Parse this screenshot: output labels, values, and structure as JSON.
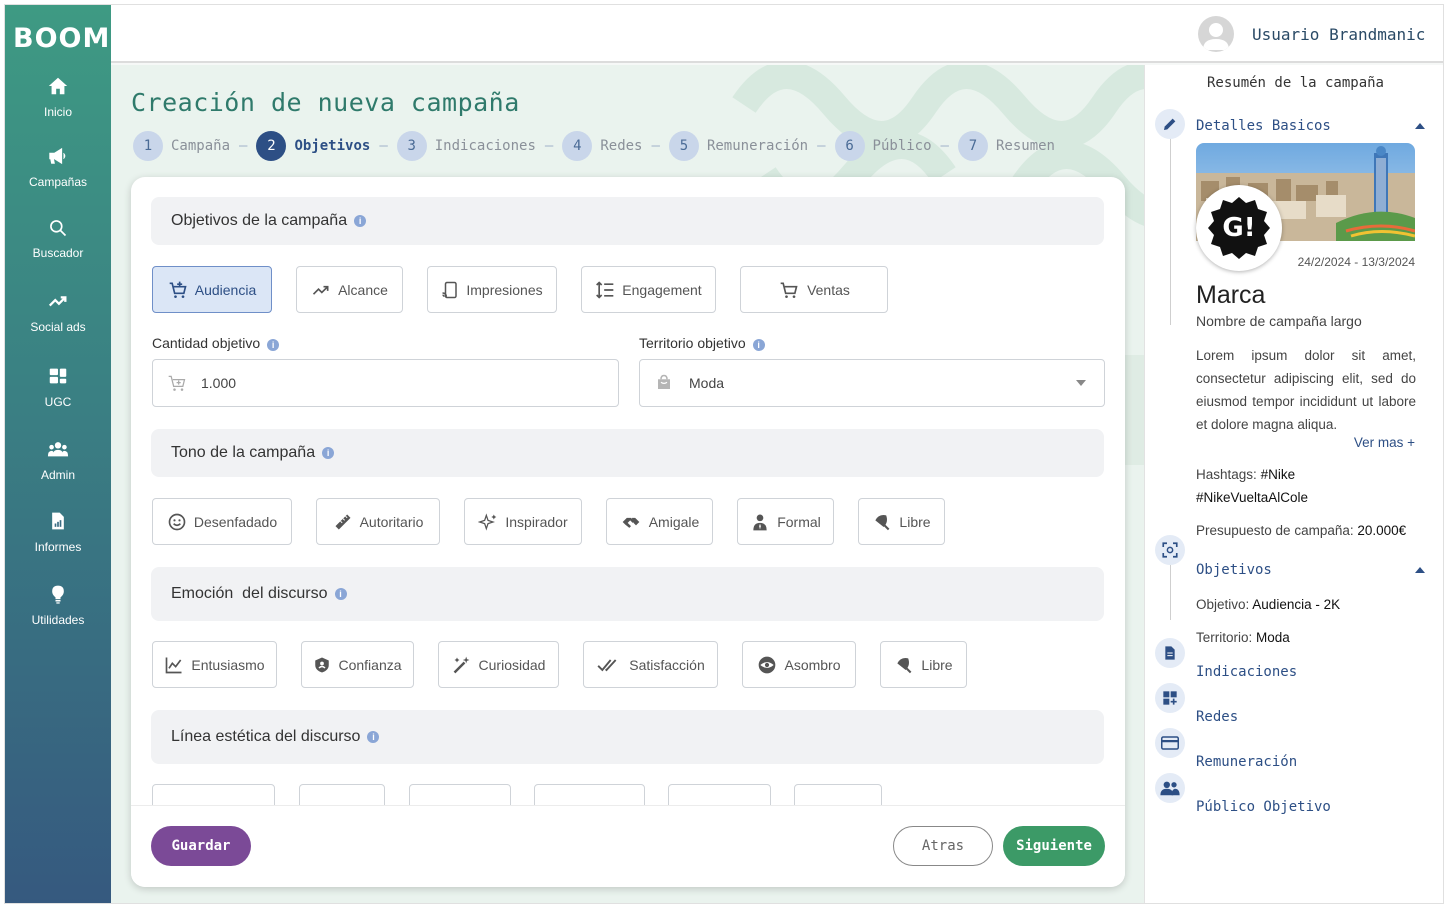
{
  "app": {
    "logo": "BOOM"
  },
  "sidebar": {
    "items": [
      {
        "label": "Inicio",
        "icon": "home-icon"
      },
      {
        "label": "Campañas",
        "icon": "megaphone-icon"
      },
      {
        "label": "Buscador",
        "icon": "search-icon"
      },
      {
        "label": "Social ads",
        "icon": "trending-up-icon"
      },
      {
        "label": "UGC",
        "icon": "dashboard-icon"
      },
      {
        "label": "Admin",
        "icon": "group-icon"
      },
      {
        "label": "Informes",
        "icon": "report-icon"
      },
      {
        "label": "Utilidades",
        "icon": "lightbulb-icon"
      }
    ]
  },
  "header": {
    "username": "Usuario Brandmanic"
  },
  "main": {
    "title": "Creación de nueva campaña",
    "steps": [
      {
        "num": "1",
        "label": "Campaña"
      },
      {
        "num": "2",
        "label": "Objetivos"
      },
      {
        "num": "3",
        "label": "Indicaciones"
      },
      {
        "num": "4",
        "label": "Redes"
      },
      {
        "num": "5",
        "label": "Remuneración"
      },
      {
        "num": "6",
        "label": "Público"
      },
      {
        "num": "7",
        "label": "Resumen"
      }
    ],
    "active_step": 2,
    "objectives_header": "Objetivos de la campaña",
    "objectives": [
      "Audiencia",
      "Alcance",
      "Impresiones",
      "Engagement",
      "Ventas"
    ],
    "selected_objective": "Audiencia",
    "quantity_label": "Cantidad objetivo",
    "quantity_value": "1.000",
    "territory_label": "Territorio objetivo",
    "territory_value": "Moda",
    "tone_header": "Tono de la campaña",
    "tones": [
      "Desenfadado",
      "Autoritario",
      "Inspirador",
      "Amigale",
      "Formal",
      "Libre"
    ],
    "emotion_header": "Emoción  del discurso",
    "emotions": [
      "Entusiasmo",
      "Confianza",
      "Curiosidad",
      "Satisfacción",
      "Asombro",
      "Libre"
    ],
    "aesthetic_header": "Línea estética del discurso",
    "buttons": {
      "save": "Guardar",
      "back": "Atras",
      "next": "Siguiente"
    }
  },
  "summary": {
    "title": "Resumén de la campaña",
    "details_header": "Detalles Basicos",
    "dates": "24/2/2024 - 13/3/2024",
    "brand_logo_text": "G!",
    "brand": "Marca",
    "campaign_name": "Nombre de campaña largo",
    "description": "Lorem ipsum dolor sit amet, consectetur adipiscing elit, sed do eiusmod tempor incididunt ut labore et dolore magna aliqua.",
    "see_more": "Ver mas +",
    "hashtags_label": "Hashtags:",
    "hashtags_value_1": "#Nike",
    "hashtags_value_2": "#NikeVueltaAlCole",
    "budget_label": "Presupuesto de campaña:",
    "budget_value": "20.000€",
    "objectives_header": "Objetivos",
    "objective_label": "Objetivo:",
    "objective_value": "Audiencia - 2K",
    "territory_label": "Territorio:",
    "territory_value": "Moda",
    "indications_header": "Indicaciones",
    "networks_header": "Redes",
    "remuneration_header": "Remuneración",
    "audience_header": "Público Objetivo"
  },
  "colors": {
    "accent": "#2d4f85",
    "title": "#2f7a6b",
    "save": "#7b4a97",
    "next": "#3c9a67"
  }
}
